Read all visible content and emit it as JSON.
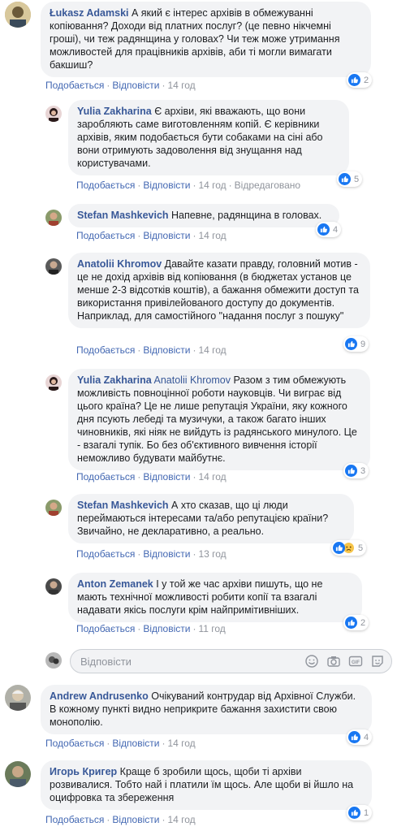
{
  "comments": [
    {
      "author": "Łukasz Adamski",
      "text": " А який є інтерес архівів в обмежуванні копіювання? Доходи від платних послуг? (це певно нікчемні гроші), чи теж радянщина у головах? Чи теж може утримання можливостей для працівників архівів, аби ті могли вимагати бакшиш?",
      "like": "Подобається",
      "reply": "Відповісти",
      "time": "14 год",
      "edited": "",
      "reactions": "2"
    },
    {
      "author": "Yulia Zakharina",
      "text": " Є архіви, які вважають, що вони заробляють саме виготовленням копій. Є керівники архівів, яким подобається бути собаками на сіні або вони отримують задоволення від знущання над користувачами.",
      "like": "Подобається",
      "reply": "Відповісти",
      "time": "14 год",
      "edited": "Відредаговано",
      "reactions": "5"
    },
    {
      "author": "Stefan Mashkevich",
      "text": " Напевне, радянщина в головах.",
      "like": "Подобається",
      "reply": "Відповісти",
      "time": "14 год",
      "edited": "",
      "reactions": "4"
    },
    {
      "author": "Anatolii Khromov",
      "text": " Давайте казати правду, головний мотив - це не дохід архівів від копіювання (в бюджетах установ це менше 2-3 відсотків коштів), а бажання обмежити доступ та використання привілейованого доступу до документів. Наприклад, для самостійного \"надання послуг з пошуку\"",
      "like": "Подобається",
      "reply": "Відповісти",
      "time": "14 год",
      "edited": "",
      "reactions": "9"
    },
    {
      "author": "Yulia Zakharina",
      "mention": " Anatolii Khromov",
      "text": " Разом з тим обмежують можливість повноцінної роботи науковців. Чи виграє від цього країна? Це не лише репутація України, яку кожного дня псують лебеді та музичуки, а також багато інших чиновників, які ніяк не вийдуть із радянського минулого. Це - взагалі тупік. Бо без об'єктивного вивчення історії неможливо будувати майбутнє.",
      "like": "Подобається",
      "reply": "Відповісти",
      "time": "14 год",
      "edited": "",
      "reactions": "3"
    },
    {
      "author": "Stefan Mashkevich",
      "text": " А хто сказав, що ці люди переймаються інтересами та/або репутацією країни? Звичайно, не декларативно, а реально.",
      "like": "Подобається",
      "reply": "Відповісти",
      "time": "13 год",
      "edited": "",
      "reactions": "5"
    },
    {
      "author": "Anton Zemanek",
      "text": " І у той же час архіви пишуть, що не мають технічної можливості робити копії та взагалі надавати якісь послуги крім найпримітивніших.",
      "like": "Подобається",
      "reply": "Відповісти",
      "time": "11 год",
      "edited": "",
      "reactions": "2"
    },
    {
      "author": "Andrew Andrusenko",
      "text": " Очікуваний контрудар від Архівної Служби. В кожному пункті видно неприкрите бажання захистити свою монополію.",
      "like": "Подобається",
      "reply": "Відповісти",
      "time": "14 год",
      "edited": "",
      "reactions": "4"
    },
    {
      "author": "Игорь Кригер",
      "text": " Краще б зробили щось, щоби ті архіви розвивалися. Тобто най і платили їм щось. Але щоби ві йшло на оцифровка та збереження",
      "like": "Подобається",
      "reply": "Відповісти",
      "time": "14 год",
      "edited": "",
      "reactions": "1"
    }
  ],
  "reply_box": {
    "placeholder": "Відповісти"
  },
  "colors": {
    "link": "#385898",
    "action": "#4267b2",
    "bubble": "#f2f3f5",
    "like": "#1877f2",
    "meta": "#90949c"
  },
  "icons": [
    "like-icon",
    "sad-icon",
    "emoji-icon",
    "camera-icon",
    "gif-icon",
    "sticker-icon"
  ]
}
